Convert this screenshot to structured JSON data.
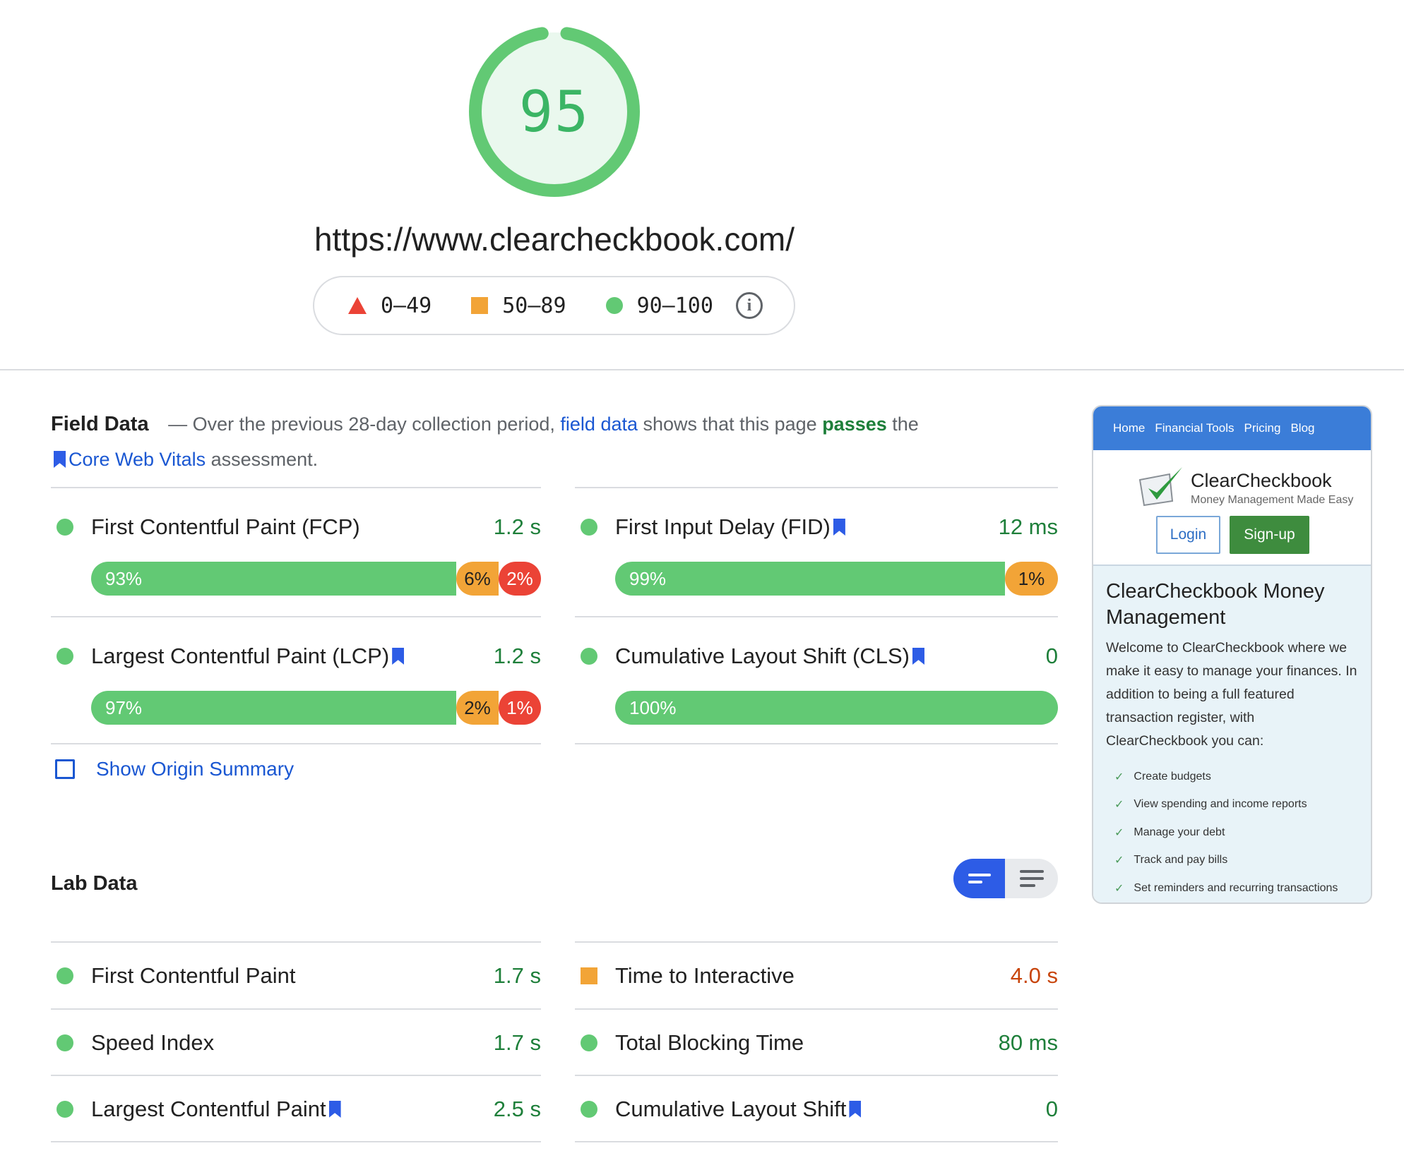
{
  "score": {
    "value": "95",
    "fraction": 0.95,
    "ring_color": "#62c974",
    "fill_color": "#eaf8ee"
  },
  "url": "https://www.clearcheckbook.com/",
  "legend": {
    "items": [
      {
        "icon": "triangle-icon",
        "range": "0–49",
        "color": "#eb4336"
      },
      {
        "icon": "square-icon",
        "range": "50–89",
        "color": "#f2a437"
      },
      {
        "icon": "circle-icon",
        "range": "90–100",
        "color": "#62c974"
      }
    ],
    "info_icon": "info-icon"
  },
  "field_data": {
    "heading": "Field Data",
    "desc_1": "— Over the previous 28-day collection period,",
    "link_field": "field data",
    "desc_2": "shows that this page",
    "passes": "passes",
    "desc_3": "the",
    "link_cwv": "Core Web Vitals",
    "desc_4": "assessment.",
    "metrics": [
      {
        "name": "First Contentful Paint (FCP)",
        "value": "1.2 s",
        "good": "93%",
        "ni": "6%",
        "poor": "2%",
        "good_pct": 93,
        "ni_pct": 6,
        "poor_pct": 2,
        "bookmark": false
      },
      {
        "name": "First Input Delay (FID)",
        "value": "12 ms",
        "good": "99%",
        "ni": "1%",
        "poor": "",
        "good_pct": 99,
        "ni_pct": 1,
        "poor_pct": 0,
        "bookmark": true
      },
      {
        "name": "Largest Contentful Paint (LCP)",
        "value": "1.2 s",
        "good": "97%",
        "ni": "2%",
        "poor": "1%",
        "good_pct": 97,
        "ni_pct": 2,
        "poor_pct": 1,
        "bookmark": true
      },
      {
        "name": "Cumulative Layout Shift (CLS)",
        "value": "0",
        "good": "100%",
        "ni": "",
        "poor": "",
        "good_pct": 100,
        "ni_pct": 0,
        "poor_pct": 0,
        "bookmark": true
      }
    ],
    "origin_summary": "Show Origin Summary"
  },
  "lab_data": {
    "heading": "Lab Data",
    "metrics": [
      {
        "name": "First Contentful Paint",
        "value": "1.7 s",
        "status": "good"
      },
      {
        "name": "Time to Interactive",
        "value": "4.0 s",
        "status": "average"
      },
      {
        "name": "Speed Index",
        "value": "1.7 s",
        "status": "good"
      },
      {
        "name": "Total Blocking Time",
        "value": "80 ms",
        "status": "good"
      },
      {
        "name": "Largest Contentful Paint",
        "value": "2.5 s",
        "status": "good"
      },
      {
        "name": "Cumulative Layout Shift",
        "value": "0",
        "status": "good"
      }
    ]
  },
  "thumbnail": {
    "nav": [
      "Home",
      "Financial Tools",
      "Pricing",
      "Blog"
    ],
    "brand": "ClearCheckbook",
    "tagline": "Money Management Made Easy",
    "login": "Login",
    "signup": "Sign-up",
    "heading": "ClearCheckbook Money Management",
    "paragraph": "Welcome to ClearCheckbook where we make it easy to manage your finances. In addition to being a full featured transaction register, with ClearCheckbook you can:",
    "list": [
      "Create budgets",
      "View spending and income reports",
      "Manage your debt",
      "Track and pay bills",
      "Set reminders and recurring transactions"
    ]
  },
  "colors": {
    "good": "#1e7f3a",
    "average": "#c8450b",
    "link": "#1a57d2",
    "accent": "#2d5ce6"
  }
}
